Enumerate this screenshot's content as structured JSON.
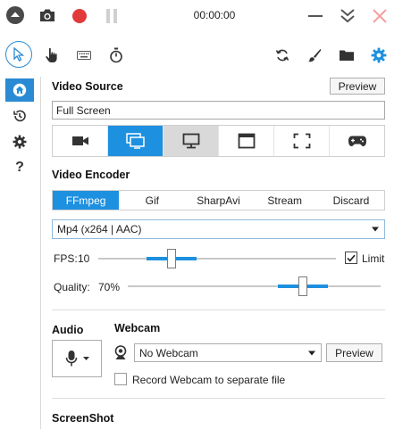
{
  "titlebar": {
    "timer": "00:00:00",
    "colors": {
      "record": "#e23a3a",
      "close": "#f2a0a0",
      "pause": "#d0d0d0"
    }
  },
  "toolbar": {
    "tools": [
      "cursor-icon",
      "hand-pointer-icon",
      "keyboard-icon",
      "stopwatch-icon"
    ],
    "right_tools": [
      "refresh-icon",
      "brush-icon",
      "folder-icon",
      "gear-icon"
    ],
    "accent": "#1e90e0"
  },
  "sidenav": {
    "items": [
      "home-icon",
      "history-icon",
      "settings-icon"
    ],
    "help_label": "?"
  },
  "video_source": {
    "title": "Video Source",
    "preview_label": "Preview",
    "source_value": "Full Screen",
    "sources": [
      "camera-icon",
      "screen-icon",
      "monitor-icon",
      "window-icon",
      "region-icon",
      "gamepad-icon"
    ]
  },
  "video_encoder": {
    "title": "Video Encoder",
    "tabs": [
      "FFmpeg",
      "Gif",
      "SharpAvi",
      "Stream",
      "Discard"
    ],
    "codec_value": "Mp4 (x264 | AAC)",
    "fps_label": "FPS:",
    "fps_value": "10",
    "fps_fraction": 0.3,
    "limit_label": "Limit",
    "quality_label": "Quality:",
    "quality_value": "70%",
    "quality_fraction": 0.7
  },
  "audio": {
    "title": "Audio"
  },
  "webcam": {
    "title": "Webcam",
    "selected": "No Webcam",
    "preview_label": "Preview",
    "separate_file_label": "Record Webcam to separate file"
  },
  "screenshot": {
    "title": "ScreenShot"
  }
}
